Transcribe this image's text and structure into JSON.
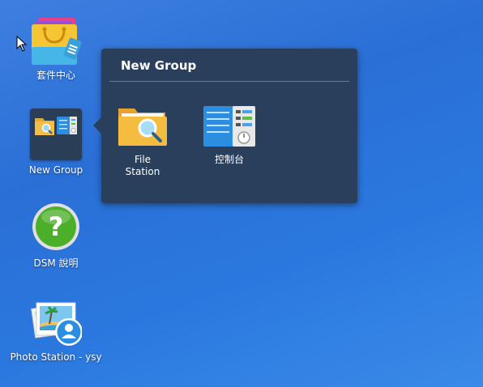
{
  "desktop": {
    "icons": [
      {
        "label": "套件中心",
        "icon": "package-center-icon"
      },
      {
        "label": "New Group",
        "icon": "group-folder-icon"
      },
      {
        "label": "DSM 說明",
        "icon": "help-icon"
      },
      {
        "label": "Photo Station - ysy",
        "icon": "photo-station-icon"
      }
    ]
  },
  "popup": {
    "title": "New Group",
    "apps": [
      {
        "label": "File Station",
        "icon": "file-station-icon"
      },
      {
        "label": "控制台",
        "icon": "control-panel-icon"
      }
    ]
  },
  "colors": {
    "desktop_bg": "#2a6fd6",
    "popup_bg": "#2a3f5b",
    "help_green": "#4caf2a"
  }
}
